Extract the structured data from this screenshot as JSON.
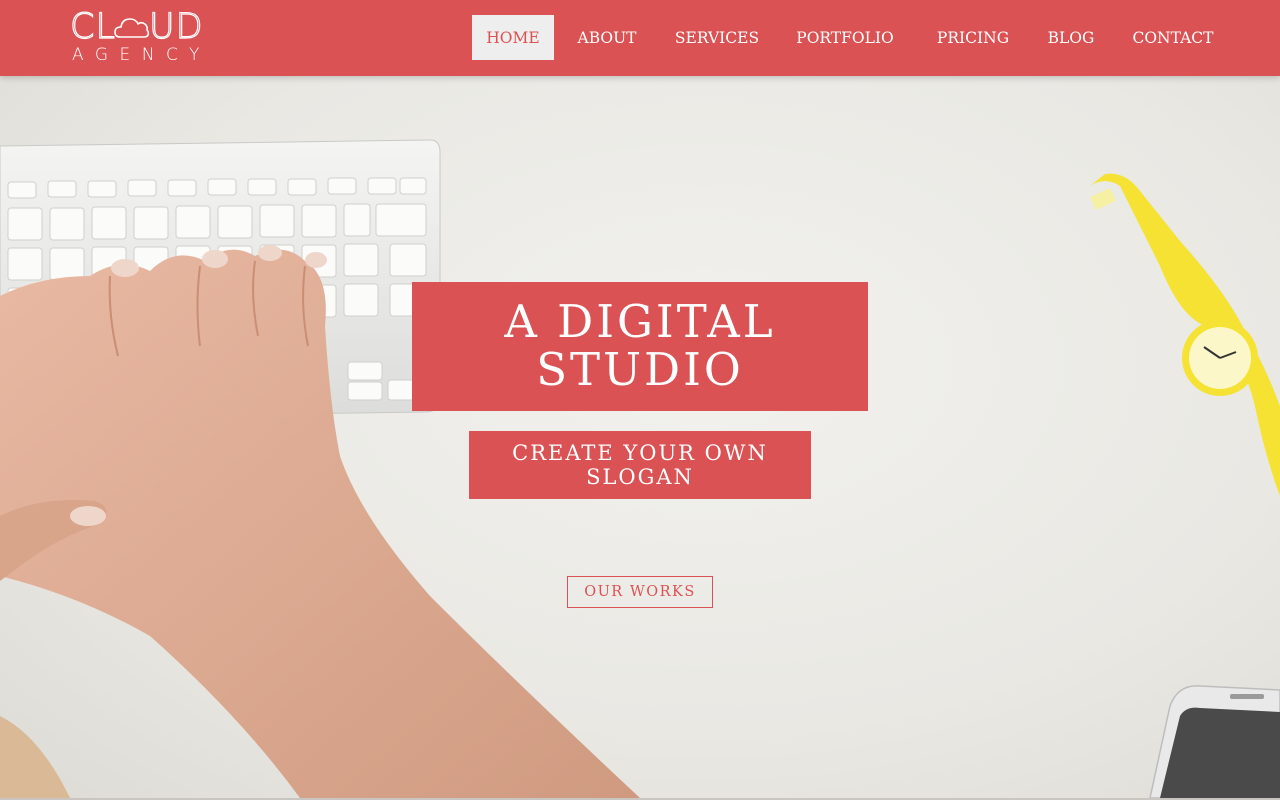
{
  "brand": {
    "name_left": "CL",
    "name_right": "UD",
    "sub": "AGENCY",
    "logo_icon": "cloud-icon"
  },
  "nav": {
    "items": [
      {
        "label": "HOME",
        "active": true
      },
      {
        "label": "ABOUT",
        "active": false
      },
      {
        "label": "SERVICES",
        "active": false
      },
      {
        "label": "PORTFOLIO",
        "active": false
      },
      {
        "label": "PRICING",
        "active": false
      },
      {
        "label": "BLOG",
        "active": false
      },
      {
        "label": "CONTACT",
        "active": false
      }
    ]
  },
  "hero": {
    "title_line1": "A DIGITAL",
    "title_line2": "STUDIO",
    "slogan_line1": "CREATE YOUR OWN",
    "slogan_line2": "SLOGAN",
    "cta_label": "OUR WORKS"
  },
  "colors": {
    "brand": "#db5254",
    "nav_active_bg": "#eeeeee",
    "hero_bg": "#eceae6",
    "watch": "#f5e232"
  }
}
